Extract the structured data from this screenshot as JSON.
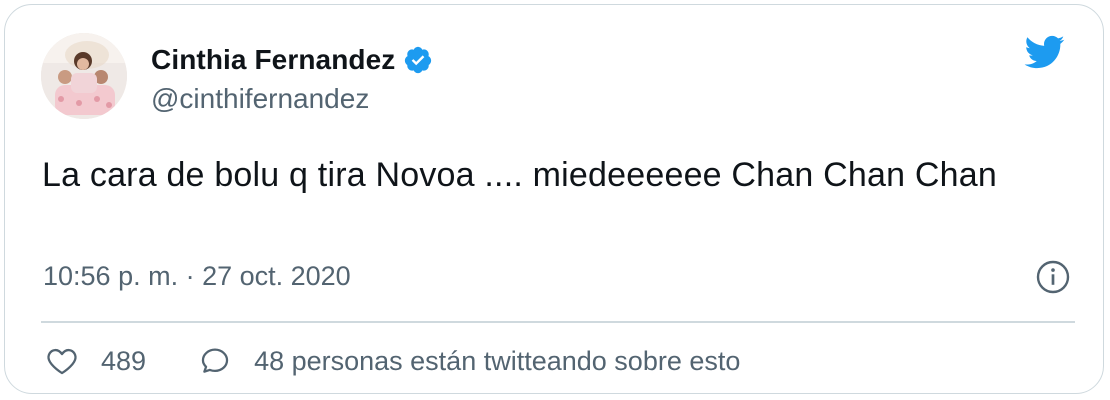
{
  "tweet": {
    "author": {
      "display_name": "Cinthia Fernandez",
      "handle": "@cinthifernandez",
      "verified": true
    },
    "text": "La cara de bolu q tira Novoa .... miedeeeeee Chan Chan Chan",
    "timestamp": "10:56 p. m. · 27 oct. 2020",
    "likes": "489",
    "conversation": "48 personas están twitteando sobre esto"
  },
  "icons": {
    "brand": "twitter-bird-icon",
    "verified": "verified-badge-icon",
    "info": "info-icon",
    "like": "heart-icon",
    "reply": "speech-bubble-icon"
  },
  "colors": {
    "brand_blue": "#1d9bf0",
    "text_primary": "#0f1419",
    "text_secondary": "#536471",
    "border": "#cfd9de"
  }
}
